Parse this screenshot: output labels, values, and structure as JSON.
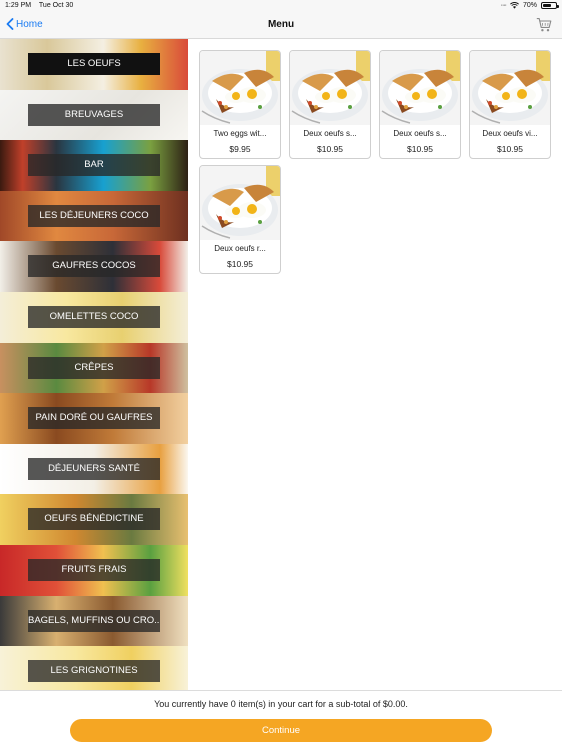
{
  "status_bar": {
    "time": "1:29 PM",
    "date": "Tue Oct 30",
    "battery_text": "70%",
    "battery_level": 0.7
  },
  "nav": {
    "back_label": "Home",
    "title": "Menu"
  },
  "categories": [
    {
      "label": "LES OEUFS",
      "active": true
    },
    {
      "label": "BREUVAGES",
      "active": false
    },
    {
      "label": "BAR",
      "active": false
    },
    {
      "label": "LES DÉJEUNERS COCO",
      "active": false
    },
    {
      "label": "GAUFRES COCOS",
      "active": false
    },
    {
      "label": "OMELETTES COCO",
      "active": false
    },
    {
      "label": "CRÊPES",
      "active": false
    },
    {
      "label": "PAIN DORÉ OU GAUFRES",
      "active": false
    },
    {
      "label": "DÉJEUNERS SANTÉ",
      "active": false
    },
    {
      "label": "OEUFS BÉNÉDICTINE",
      "active": false
    },
    {
      "label": "FRUITS FRAIS",
      "active": false
    },
    {
      "label": "BAGELS, MUFFINS OU CRO...",
      "active": false
    },
    {
      "label": "LES GRIGNOTINES",
      "active": false
    }
  ],
  "products": [
    {
      "name": "Two eggs wit...",
      "price": "$9.95"
    },
    {
      "name": "Deux oeufs s...",
      "price": "$10.95"
    },
    {
      "name": "Deux oeufs s...",
      "price": "$10.95"
    },
    {
      "name": "Deux oeufs vi...",
      "price": "$10.95"
    },
    {
      "name": "Deux oeufs r...",
      "price": "$10.95"
    }
  ],
  "footer": {
    "cart_summary": "You currently have 0 item(s) in your cart for a sub-total of $0.00.",
    "continue_label": "Continue"
  },
  "colors": {
    "accent": "#f5a623",
    "link": "#1a7bf2"
  }
}
